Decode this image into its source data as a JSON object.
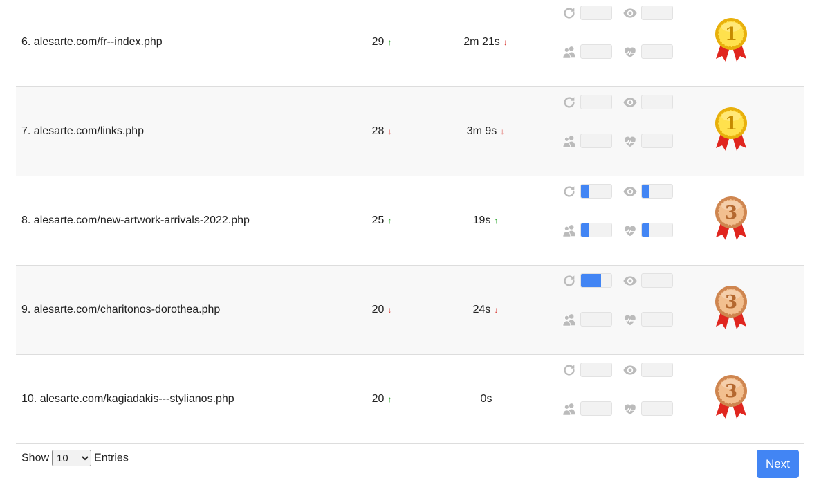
{
  "rows": [
    {
      "label": "6. alesarte.com/fr--index.php",
      "visits": "29",
      "visits_trend": "up",
      "duration": "2m 21s",
      "duration_trend": "down",
      "medal": "1",
      "fills": {
        "sessions": 0,
        "views": 0,
        "visitors": 0,
        "likes": 0
      }
    },
    {
      "label": "7. alesarte.com/links.php",
      "visits": "28",
      "visits_trend": "down",
      "duration": "3m 9s",
      "duration_trend": "down",
      "medal": "1",
      "fills": {
        "sessions": 0,
        "views": 0,
        "visitors": 0,
        "likes": 0
      }
    },
    {
      "label": "8. alesarte.com/new-artwork-arrivals-2022.php",
      "visits": "25",
      "visits_trend": "up",
      "duration": "19s",
      "duration_trend": "up",
      "medal": "3",
      "fills": {
        "sessions": 0.25,
        "views": 0.25,
        "visitors": 0.25,
        "likes": 0.25
      }
    },
    {
      "label": "9. alesarte.com/charitonos-dorothea.php",
      "visits": "20",
      "visits_trend": "down",
      "duration": "24s",
      "duration_trend": "down",
      "medal": "3",
      "fills": {
        "sessions": 0.67,
        "views": 0,
        "visitors": 0,
        "likes": 0
      }
    },
    {
      "label": "10. alesarte.com/kagiadakis---stylianos.php",
      "visits": "20",
      "visits_trend": "up",
      "duration": "0s",
      "duration_trend": "none",
      "medal": "3",
      "fills": {
        "sessions": 0,
        "views": 0,
        "visitors": 0,
        "likes": 0
      }
    }
  ],
  "icons": {
    "sessions": "refresh-icon",
    "views": "eye-icon",
    "visitors": "users-icon",
    "likes": "heart-icon"
  },
  "arrows": {
    "up": "↑",
    "down": "↓",
    "none": ""
  },
  "colors": {
    "accent": "#4285f4",
    "up": "#2aa52a",
    "down": "#d9413a",
    "gold": "#f5c518",
    "bronze": "#e0a06a",
    "ribbon": "#e0261f"
  },
  "footer": {
    "show_label": "Show",
    "entries_label": "Entries",
    "page_size": "10",
    "next_label": "Next"
  }
}
